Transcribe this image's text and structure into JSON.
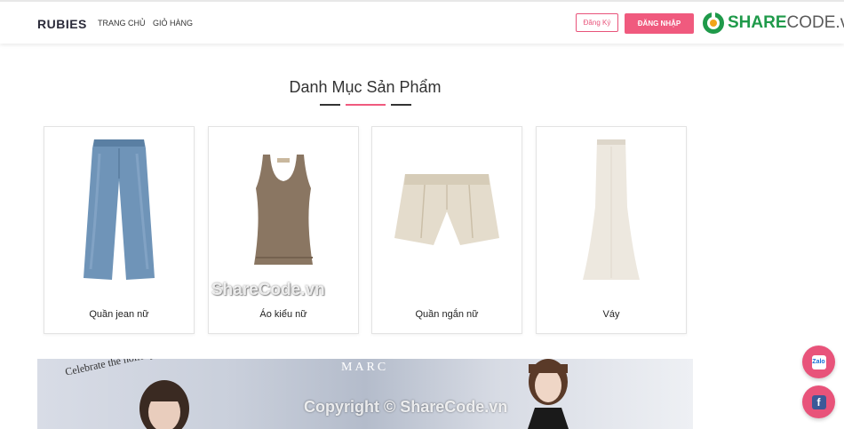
{
  "header": {
    "brand": "RUBIES",
    "nav": [
      {
        "label": "TRANG CHỦ"
      },
      {
        "label": "GIỎ HÀNG"
      }
    ],
    "register_label": "Đăng Ký",
    "login_label": "ĐĂNG NHẬP",
    "partner_logo": {
      "bold": "SHARE",
      "light": "CODE.vn"
    }
  },
  "section": {
    "title": "Danh Mục Sản Phẩm"
  },
  "categories": [
    {
      "label": "Quần jean nữ",
      "icon": "jeans-image"
    },
    {
      "label": "Áo kiểu nữ",
      "icon": "tank-top-image"
    },
    {
      "label": "Quần ngắn nữ",
      "icon": "shorts-image"
    },
    {
      "label": "Váy",
      "icon": "skirt-image"
    }
  ],
  "watermark": "ShareCode.vn",
  "banner": {
    "tagline": "Celebrate the holidays with the beauty touch that",
    "brand": "MARC",
    "copyright": "Copyright © ShareCode.vn"
  },
  "floating": {
    "zalo_label": "Zalo",
    "facebook_label": "f"
  },
  "colors": {
    "accent": "#f05a7e",
    "brand_green": "#1f9a4a"
  }
}
